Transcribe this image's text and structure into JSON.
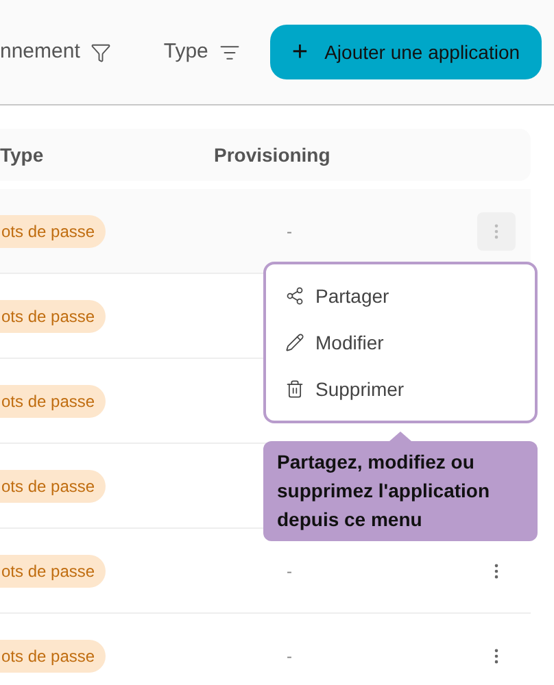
{
  "toolbar": {
    "filters": [
      {
        "label": "nnement"
      },
      {
        "label": "Type"
      }
    ],
    "add_button": {
      "icon": "+",
      "label": "Ajouter une application"
    }
  },
  "table": {
    "columns": [
      "Type",
      "Provisioning"
    ],
    "rows": [
      {
        "type": "ots de passe",
        "provisioning": "-",
        "menu_open": true
      },
      {
        "type": "ots de passe"
      },
      {
        "type": "ots de passe"
      },
      {
        "type": "ots de passe"
      },
      {
        "type": "ots de passe",
        "provisioning": "-",
        "menu_open": false
      },
      {
        "type": "ots de passe",
        "provisioning": "-",
        "menu_open": false
      }
    ]
  },
  "menu": {
    "items": [
      {
        "label": "Partager"
      },
      {
        "label": "Modifier"
      },
      {
        "label": "Supprimer"
      }
    ]
  },
  "tooltip": {
    "text": "Partagez, modifiez ou supprimez l'application depuis ce menu"
  }
}
